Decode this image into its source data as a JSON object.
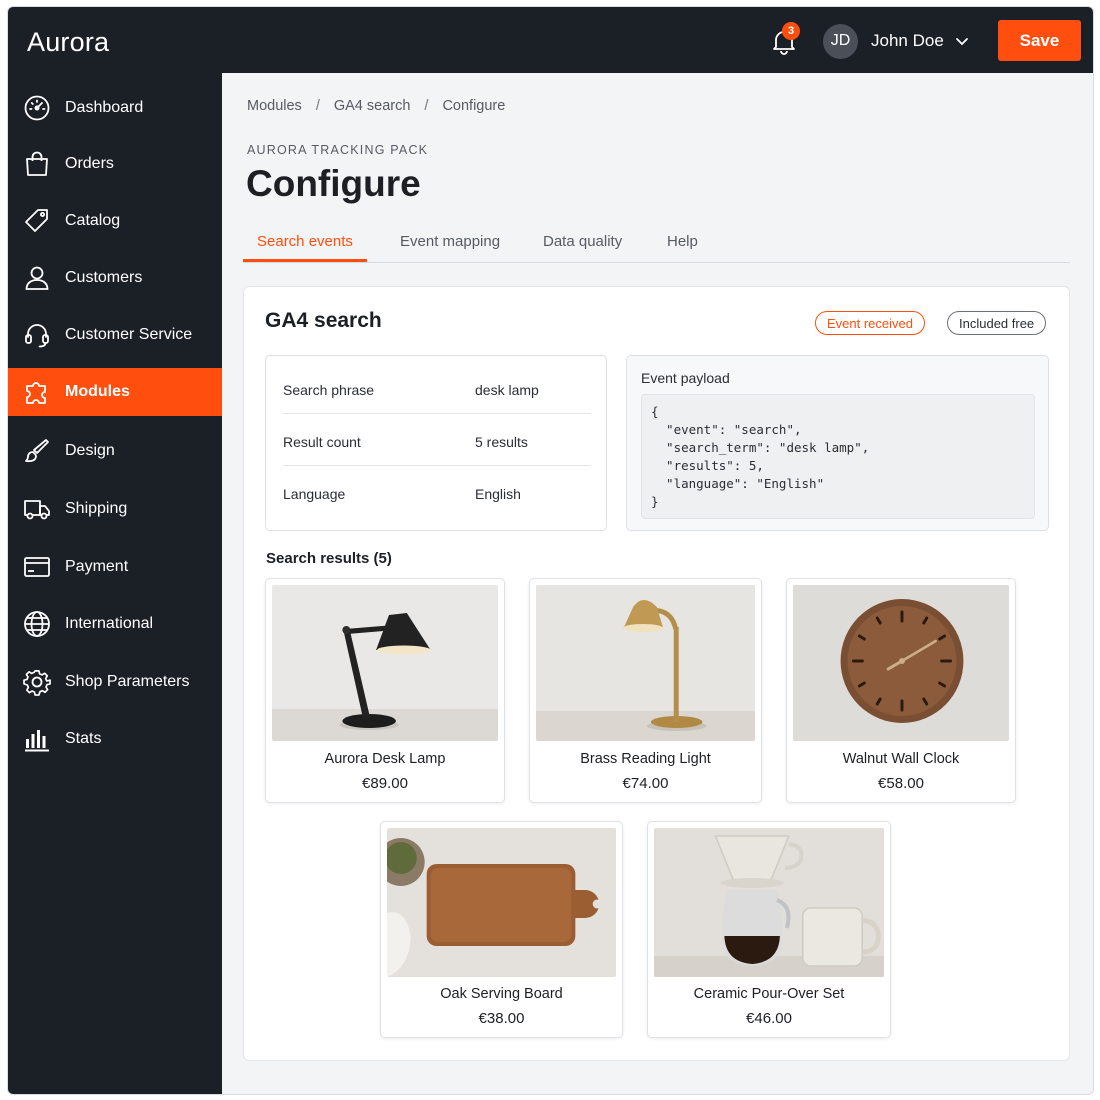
{
  "app": {
    "brand": "Aurora"
  },
  "sidebar": {
    "items": [
      {
        "label": "Dashboard",
        "icon": "dashboard-icon"
      },
      {
        "label": "Orders",
        "icon": "shopping-bag-icon"
      },
      {
        "label": "Catalog",
        "icon": "tag-icon"
      },
      {
        "label": "Customers",
        "icon": "user-icon"
      },
      {
        "label": "Customer Service",
        "icon": "headset-icon"
      },
      {
        "label": "Modules",
        "icon": "puzzle-icon",
        "active": true
      },
      {
        "label": "Design",
        "icon": "brush-icon"
      },
      {
        "label": "Shipping",
        "icon": "truck-icon"
      },
      {
        "label": "Payment",
        "icon": "credit-card-icon"
      },
      {
        "label": "International",
        "icon": "globe-icon"
      },
      {
        "label": "Shop Parameters",
        "icon": "gear-icon"
      },
      {
        "label": "Stats",
        "icon": "bar-chart-icon"
      }
    ]
  },
  "topbar": {
    "notification_count": "3",
    "user_initials": "JD",
    "user_name": "John Doe",
    "save_label": "Save"
  },
  "breadcrumb": [
    "Modules",
    "GA4 search",
    "Configure"
  ],
  "header": {
    "kicker": "AURORA TRACKING PACK",
    "title": "Configure"
  },
  "tabs": [
    {
      "label": "Search events",
      "active": true
    },
    {
      "label": "Event mapping"
    },
    {
      "label": "Data quality"
    },
    {
      "label": "Help"
    }
  ],
  "card": {
    "title": "GA4 search",
    "badge_status": "Event received",
    "badge_plan": "Included free",
    "details": [
      {
        "key": "Search phrase",
        "value": "desk lamp"
      },
      {
        "key": "Result count",
        "value": "5 results"
      },
      {
        "key": "Language",
        "value": "English"
      }
    ],
    "payload_label": "Event payload",
    "payload_code": "{\n  \"event\": \"search\",\n  \"search_term\": \"desk lamp\",\n  \"results\": 5,\n  \"language\": \"English\"\n}",
    "results_title": "Search results (5)",
    "products": [
      {
        "name": "Aurora Desk Lamp",
        "price": "€89.00"
      },
      {
        "name": "Brass Reading Light",
        "price": "€74.00"
      },
      {
        "name": "Walnut Wall Clock",
        "price": "€58.00"
      },
      {
        "name": "Oak Serving Board",
        "price": "€38.00"
      },
      {
        "name": "Ceramic Pour-Over Set",
        "price": "€46.00"
      }
    ]
  },
  "colors": {
    "accent": "#ff4e0e",
    "sidebar_bg": "#1b1f26",
    "page_bg": "#f3f4f6"
  }
}
